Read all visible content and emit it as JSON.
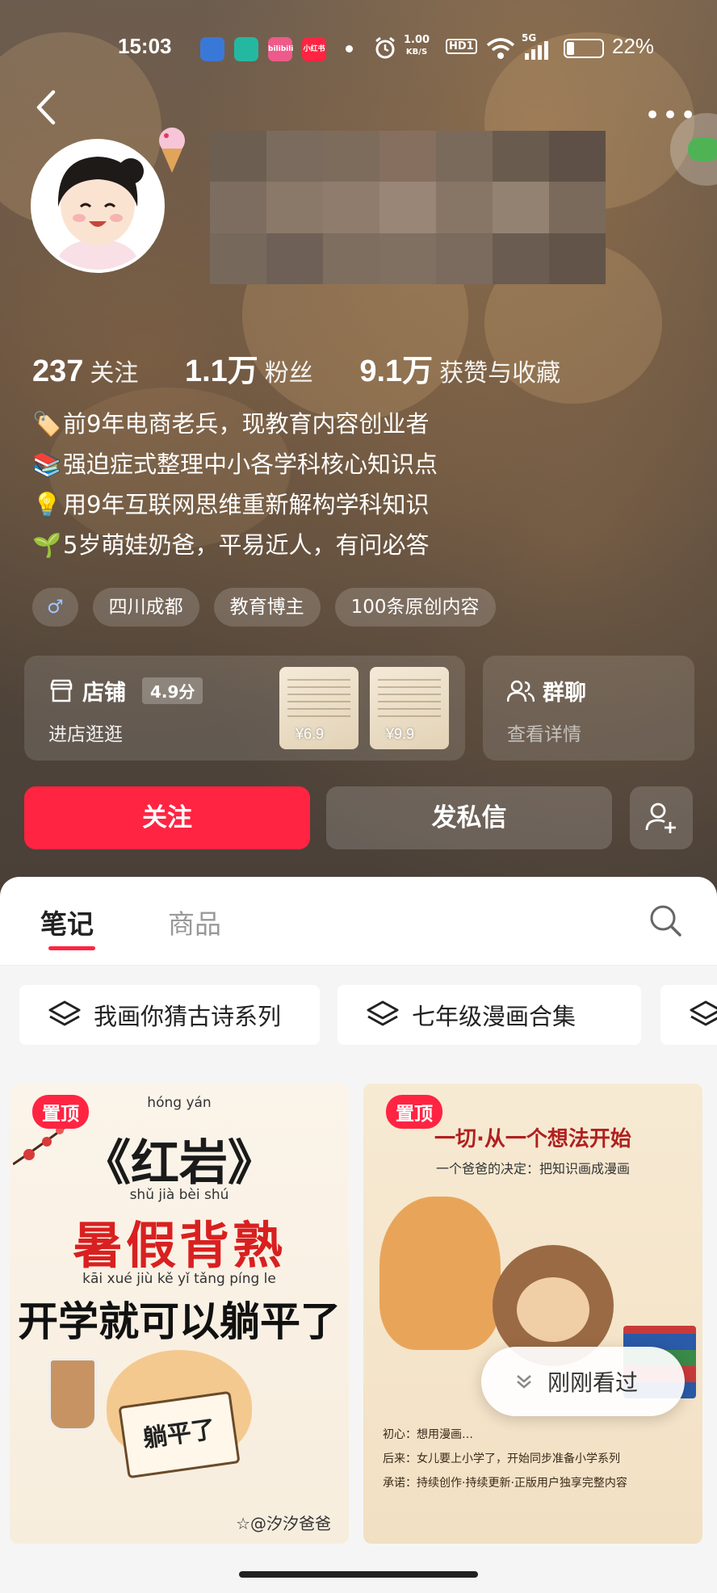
{
  "status_bar": {
    "time": "15:03",
    "network_speed": "1.00",
    "network_speed_unit": "KB/S",
    "hd_label": "HD1",
    "signal_label": "5G",
    "battery_pct": "22%",
    "battery_level": 0.22,
    "app_icons": [
      "browser-icon",
      "refresh-app-icon",
      "bilibili-app-icon",
      "xiaohongshu-app-icon"
    ],
    "app_icon_labels": [
      "",
      "",
      "bilibili",
      "小红书"
    ]
  },
  "profile": {
    "stats": [
      {
        "value": "237",
        "label": "关注"
      },
      {
        "value": "1.1万",
        "label": "粉丝"
      },
      {
        "value": "9.1万",
        "label": "获赞与收藏"
      }
    ],
    "bio": [
      {
        "icon": "🏷️",
        "text": "前9年电商老兵，现教育内容创业者"
      },
      {
        "icon": "📚",
        "text": "强迫症式整理中小各学科核心知识点"
      },
      {
        "icon": "💡",
        "text": "用9年互联网思维重新解构学科知识"
      },
      {
        "icon": "🌱",
        "text": "5岁萌娃奶爸，平易近人，有问必答"
      }
    ],
    "gender_symbol": "♂",
    "tags": [
      "四川成都",
      "教育博主",
      "100条原创内容"
    ]
  },
  "shop": {
    "title": "店铺",
    "score": "4.9分",
    "subtitle": "进店逛逛",
    "products": [
      {
        "price": "¥6.9"
      },
      {
        "price": "¥9.9"
      }
    ]
  },
  "group_chat": {
    "title": "群聊",
    "subtitle": "查看详情"
  },
  "actions": {
    "follow_label": "关注",
    "message_label": "发私信"
  },
  "tabs": {
    "notes": "笔记",
    "products": "商品"
  },
  "collections": [
    "我画你猜古诗系列",
    "七年级漫画合集"
  ],
  "feed": [
    {
      "pin_label": "置顶",
      "pinyin_top": "hóng yán",
      "title": "《红岩》",
      "pinyin_mid": "shǔ jià bèi shú",
      "red_line": "暑假背熟",
      "pinyin_low": "kāi xué jiù kě yǐ tǎng píng le",
      "black_line": "开学就可以躺平了",
      "book_text": "躺平了",
      "signature": "☆@汐汐爸爸"
    },
    {
      "pin_label": "置顶",
      "heading": "一切·从一个想法开始",
      "subheading": "一个爸爸的决定：把知识画成漫画",
      "list": [
        "初心：想用漫画…",
        "后来：女儿要上小学了，开始同步准备小学系列",
        "承诺：持续创作·持续更新·正版用户独享完整内容"
      ]
    }
  ],
  "recently_viewed": "刚刚看过"
}
